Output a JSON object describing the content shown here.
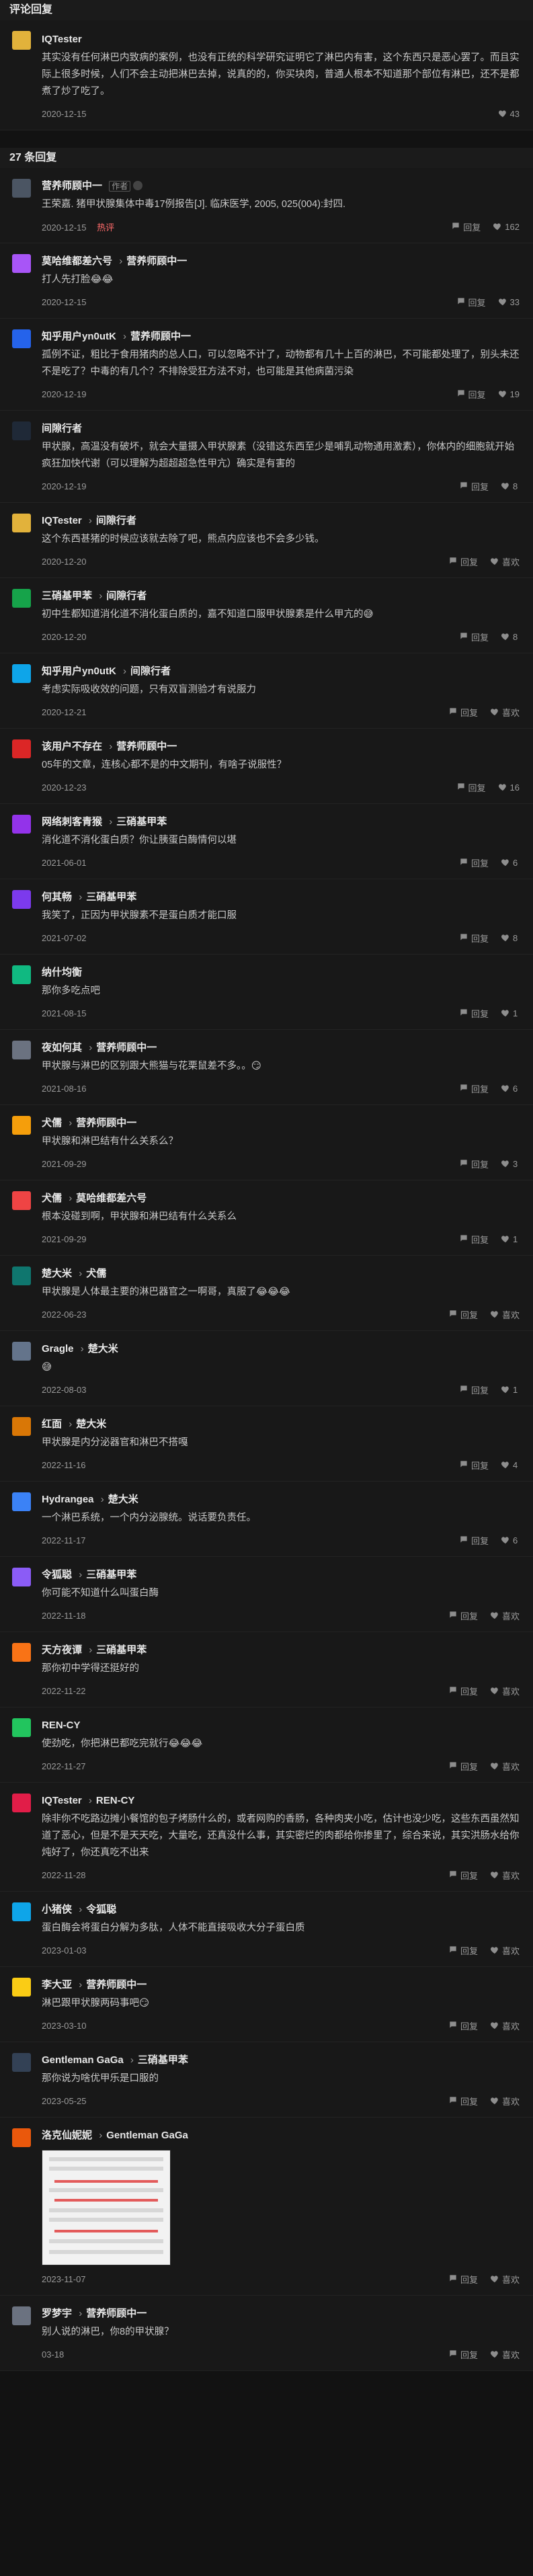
{
  "sections": {
    "reviews_title": "评论回复",
    "replies_title": "27 条回复"
  },
  "main_comment": {
    "author": "IQTester",
    "content": "其实没有任何淋巴内致病的案例，也没有正统的科学研究证明它了淋巴内有害，这个东西只是恶心罢了。而且实际上很多时候，人们不会主动把淋巴去掉，说真的的，你买块肉，普通人根本不知道那个部位有淋巴，还不是都煮了炒了吃了。",
    "date": "2020-12-15",
    "likes": "43"
  },
  "actions": {
    "reply": "回复",
    "like": "喜欢",
    "hot": "热评",
    "author_tag": "作者"
  },
  "replies": [
    {
      "author": "营养师顾中一",
      "to": "",
      "tag": true,
      "content": "王荣嘉. 猪甲状腺集体中毒17例报告[J]. 临床医学, 2005, 025(004):封四.",
      "date": "2020-12-15",
      "hot": true,
      "likes": "162"
    },
    {
      "author": "莫哈维都差六号",
      "to": "营养师顾中一",
      "content": "打人先打脸😂😂",
      "date": "2020-12-15",
      "likes": "33"
    },
    {
      "author": "知乎用户yn0utK",
      "to": "营养师顾中一",
      "content": "孤例不证，粗比于食用猪肉的总人口，可以忽略不计了，动物都有几十上百的淋巴，不可能都处理了，别头未还不是吃了？中毒的有几个？不排除受狂方法不对，也可能是其他病菌污染",
      "date": "2020-12-19",
      "likes": "19"
    },
    {
      "author": "间隙行者",
      "to": "",
      "content": "甲状腺，高温没有破坏，就会大量摄入甲状腺素（没错这东西至少是哺乳动物通用激素），你体内的细胞就开始疯狂加快代谢（可以理解为超超超急性甲亢）确实是有害的",
      "date": "2020-12-19",
      "likes": "8"
    },
    {
      "author": "IQTester",
      "to": "间隙行者",
      "content": "这个东西甚猪的时候应该就去除了吧，熊点内应该也不会多少钱。",
      "date": "2020-12-20",
      "likes": ""
    },
    {
      "author": "三硝基甲苯",
      "to": "间隙行者",
      "content": "初中生都知道消化道不消化蛋白质的，嘉不知道口服甲状腺素是什么甲亢的😅",
      "date": "2020-12-20",
      "likes": "8"
    },
    {
      "author": "知乎用户yn0utK",
      "to": "间隙行者",
      "content": "考虑实际吸收效的问题，只有双盲测验才有说服力",
      "date": "2020-12-21",
      "likes": ""
    },
    {
      "author": "该用户不存在",
      "to": "营养师顾中一",
      "content": "05年的文章，连核心都不是的中文期刊，有啥子说服性？",
      "date": "2020-12-23",
      "likes": "16"
    },
    {
      "author": "网络刺客青猴",
      "to": "三硝基甲苯",
      "content": "消化道不消化蛋白质？你让胰蛋白酶情何以堪",
      "date": "2021-06-01",
      "likes": "6"
    },
    {
      "author": "何其畅",
      "to": "三硝基甲苯",
      "content": "我笑了，正因为甲状腺素不是蛋白质才能口服",
      "date": "2021-07-02",
      "likes": "8"
    },
    {
      "author": "纳什均衡",
      "to": "",
      "content": "那你多吃点吧",
      "date": "2021-08-15",
      "likes": "1"
    },
    {
      "author": "夜如何其",
      "to": "营养师顾中一",
      "content": "甲状腺与淋巴的区别跟大熊猫与花栗鼠差不多。。😏",
      "date": "2021-08-16",
      "likes": "6"
    },
    {
      "author": "犬儒",
      "to": "营养师顾中一",
      "content": "甲状腺和淋巴结有什么关系么？",
      "date": "2021-09-29",
      "likes": "3"
    },
    {
      "author": "犬儒",
      "to": "莫哈维都差六号",
      "content": "根本没碰到啊，甲状腺和淋巴结有什么关系么",
      "date": "2021-09-29",
      "likes": "1"
    },
    {
      "author": "楚大米",
      "to": "犬儒",
      "content": "甲状腺是人体最主要的淋巴器官之一啊哥，真服了😂😂😂",
      "date": "2022-06-23",
      "likes": ""
    },
    {
      "author": "Gragle",
      "to": "楚大米",
      "content": "😅",
      "date": "2022-08-03",
      "likes": "1"
    },
    {
      "author": "红面",
      "to": "楚大米",
      "content": "甲状腺是内分泌器官和淋巴不搭嘎",
      "date": "2022-11-16",
      "likes": "4"
    },
    {
      "author": "Hydrangea",
      "to": "楚大米",
      "content": "一个淋巴系统，一个内分泌腺统。说话要负责任。",
      "date": "2022-11-17",
      "likes": "6"
    },
    {
      "author": "令狐聪",
      "to": "三硝基甲苯",
      "content": "你可能不知道什么叫蛋白酶",
      "date": "2022-11-18",
      "likes": ""
    },
    {
      "author": "天方夜谭",
      "to": "三硝基甲苯",
      "content": "那你初中学得还挺好的",
      "date": "2022-11-22",
      "likes": ""
    },
    {
      "author": "REN-CY",
      "to": "",
      "content": "使劲吃，你把淋巴都吃完就行😂😂😂",
      "date": "2022-11-27",
      "likes": ""
    },
    {
      "author": "IQTester",
      "to": "REN-CY",
      "content": "除非你不吃路边摊小餐馆的包子烤肠什么的，或者网购的香肠，各种肉夹小吃，估计也没少吃，这些东西虽然知道了恶心，但是不是天天吃，大量吃，还真没什么事，其实密烂的肉都给你掺里了，综合来说，其实洪肠水给你炖好了，你还真吃不出来",
      "date": "2022-11-28",
      "likes": ""
    },
    {
      "author": "小猪侠",
      "to": "令狐聪",
      "content": "蛋白酶会将蛋白分解为多肽，人体不能直接吸收大分子蛋白质",
      "date": "2023-01-03",
      "likes": ""
    },
    {
      "author": "李大亚",
      "to": "营养师顾中一",
      "content": "淋巴跟甲状腺两码事吧😏",
      "date": "2023-03-10",
      "likes": ""
    },
    {
      "author": "Gentleman GaGa",
      "to": "三硝基甲苯",
      "content": "那你说为啥优甲乐是口服的",
      "date": "2023-05-25",
      "likes": ""
    },
    {
      "author": "洛克仙妮妮",
      "to": "Gentleman GaGa",
      "content": "",
      "date": "2023-11-07",
      "likes": "",
      "image": true
    },
    {
      "author": "罗梦宇",
      "to": "营养师顾中一",
      "content": "别人说的淋巴，你8的甲状腺？",
      "date": "03-18",
      "likes": ""
    }
  ]
}
